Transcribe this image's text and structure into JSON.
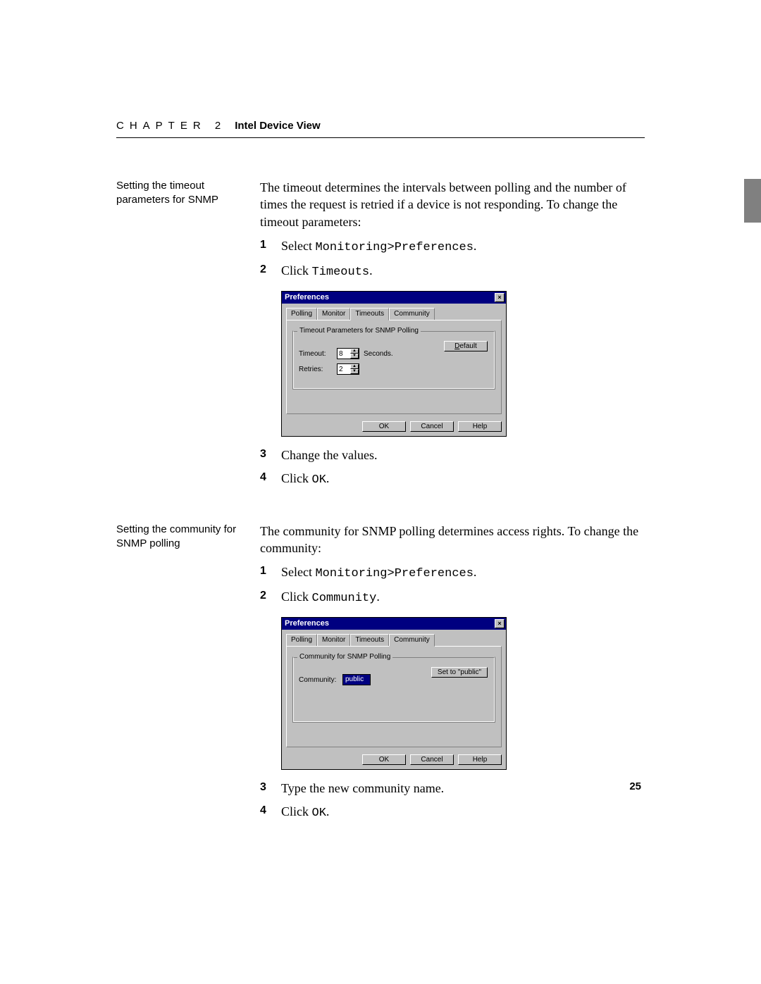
{
  "header": {
    "chapter": "CHAPTER 2",
    "title": "Intel Device View"
  },
  "page_number": "25",
  "sections": [
    {
      "side_label": "Setting the timeout parameters for SNMP",
      "intro": "The timeout determines the intervals between polling and the number of times the request is retried if a device is not responding. To change the timeout parameters:",
      "steps_before": [
        {
          "n": "1",
          "prefix": "Select ",
          "code": "Monitoring>Preferences",
          "suffix": "."
        },
        {
          "n": "2",
          "prefix": "Click ",
          "code": "Timeouts",
          "suffix": "."
        }
      ],
      "steps_after": [
        {
          "n": "3",
          "prefix": "Change the values.",
          "code": "",
          "suffix": ""
        },
        {
          "n": "4",
          "prefix": "Click ",
          "code": "OK",
          "suffix": "."
        }
      ],
      "dialog": {
        "title": "Preferences",
        "tabs": [
          "Polling",
          "Monitor",
          "Timeouts",
          "Community"
        ],
        "active_tab": "Timeouts",
        "group_title": "Timeout Parameters for SNMP Polling",
        "timeout_label": "Timeout:",
        "timeout_value": "8",
        "timeout_unit": "Seconds.",
        "retries_label": "Retries:",
        "retries_value": "2",
        "default_btn": "Default",
        "ok": "OK",
        "cancel": "Cancel",
        "help": "Help"
      }
    },
    {
      "side_label": "Setting the community for SNMP polling",
      "intro": "The community for SNMP polling determines access rights. To change the community:",
      "steps_before": [
        {
          "n": "1",
          "prefix": "Select ",
          "code": "Monitoring>Preferences",
          "suffix": "."
        },
        {
          "n": "2",
          "prefix": "Click ",
          "code": "Community",
          "suffix": "."
        }
      ],
      "steps_after": [
        {
          "n": "3",
          "prefix": "Type the new community name.",
          "code": "",
          "suffix": ""
        },
        {
          "n": "4",
          "prefix": "Click ",
          "code": "OK",
          "suffix": "."
        }
      ],
      "dialog": {
        "title": "Preferences",
        "tabs": [
          "Polling",
          "Monitor",
          "Timeouts",
          "Community"
        ],
        "active_tab": "Community",
        "group_title": "Community for SNMP Polling",
        "community_label": "Community:",
        "community_value": "public",
        "setpublic_btn": "Set to \"public\"",
        "ok": "OK",
        "cancel": "Cancel",
        "help": "Help"
      }
    }
  ]
}
